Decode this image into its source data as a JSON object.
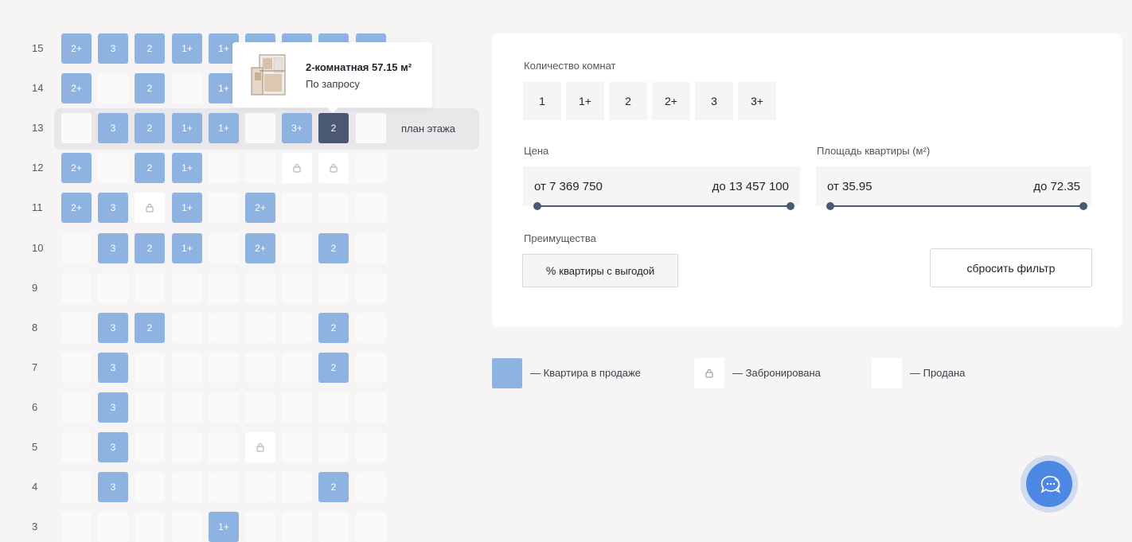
{
  "board": {
    "floors": [
      {
        "floor": "15",
        "cells": [
          {
            "s": "sale",
            "l": "2+"
          },
          {
            "s": "sale",
            "l": "3"
          },
          {
            "s": "sale",
            "l": "2"
          },
          {
            "s": "sale",
            "l": "1+"
          },
          {
            "s": "sale",
            "l": "1+"
          },
          {
            "s": "sale",
            "l": ""
          },
          {
            "s": "sale",
            "l": ""
          },
          {
            "s": "sale",
            "l": ""
          },
          {
            "s": "sale",
            "l": ""
          }
        ]
      },
      {
        "floor": "14",
        "cells": [
          {
            "s": "sale",
            "l": "2+"
          },
          {
            "s": "sold",
            "l": ""
          },
          {
            "s": "sale",
            "l": "2"
          },
          {
            "s": "sold",
            "l": ""
          },
          {
            "s": "sale",
            "l": "1+"
          },
          {
            "s": "sold",
            "l": ""
          },
          {
            "s": "sold",
            "l": ""
          },
          {
            "s": "sold",
            "l": ""
          },
          {
            "s": "sold",
            "l": ""
          }
        ]
      },
      {
        "floor": "13",
        "cells": [
          {
            "s": "sold",
            "l": ""
          },
          {
            "s": "sale",
            "l": "3"
          },
          {
            "s": "sale",
            "l": "2"
          },
          {
            "s": "sale",
            "l": "1+"
          },
          {
            "s": "sale",
            "l": "1+"
          },
          {
            "s": "sold",
            "l": ""
          },
          {
            "s": "sale",
            "l": "3+"
          },
          {
            "s": "active",
            "l": "2"
          },
          {
            "s": "sold",
            "l": ""
          }
        ]
      },
      {
        "floor": "12",
        "cells": [
          {
            "s": "sale",
            "l": "2+"
          },
          {
            "s": "sold",
            "l": ""
          },
          {
            "s": "sale",
            "l": "2"
          },
          {
            "s": "sale",
            "l": "1+"
          },
          {
            "s": "sold",
            "l": ""
          },
          {
            "s": "sold",
            "l": ""
          },
          {
            "s": "booked",
            "l": ""
          },
          {
            "s": "booked",
            "l": ""
          },
          {
            "s": "sold",
            "l": ""
          }
        ]
      },
      {
        "floor": "11",
        "cells": [
          {
            "s": "sale",
            "l": "2+"
          },
          {
            "s": "sale",
            "l": "3"
          },
          {
            "s": "booked",
            "l": ""
          },
          {
            "s": "sale",
            "l": "1+"
          },
          {
            "s": "sold",
            "l": ""
          },
          {
            "s": "sale",
            "l": "2+"
          },
          {
            "s": "sold",
            "l": ""
          },
          {
            "s": "sold",
            "l": ""
          },
          {
            "s": "sold",
            "l": ""
          }
        ]
      },
      {
        "floor": "10",
        "cells": [
          {
            "s": "sold",
            "l": ""
          },
          {
            "s": "sale",
            "l": "3"
          },
          {
            "s": "sale",
            "l": "2"
          },
          {
            "s": "sale",
            "l": "1+"
          },
          {
            "s": "sold",
            "l": ""
          },
          {
            "s": "sale",
            "l": "2+"
          },
          {
            "s": "sold",
            "l": ""
          },
          {
            "s": "sale",
            "l": "2"
          },
          {
            "s": "sold",
            "l": ""
          }
        ]
      },
      {
        "floor": "9",
        "cells": [
          {
            "s": "sold",
            "l": ""
          },
          {
            "s": "sold",
            "l": ""
          },
          {
            "s": "sold",
            "l": ""
          },
          {
            "s": "sold",
            "l": ""
          },
          {
            "s": "sold",
            "l": ""
          },
          {
            "s": "sold",
            "l": ""
          },
          {
            "s": "sold",
            "l": ""
          },
          {
            "s": "sold",
            "l": ""
          },
          {
            "s": "sold",
            "l": ""
          }
        ]
      },
      {
        "floor": "8",
        "cells": [
          {
            "s": "sold",
            "l": ""
          },
          {
            "s": "sale",
            "l": "3"
          },
          {
            "s": "sale",
            "l": "2"
          },
          {
            "s": "sold",
            "l": ""
          },
          {
            "s": "sold",
            "l": ""
          },
          {
            "s": "sold",
            "l": ""
          },
          {
            "s": "sold",
            "l": ""
          },
          {
            "s": "sale",
            "l": "2"
          },
          {
            "s": "sold",
            "l": ""
          }
        ]
      },
      {
        "floor": "7",
        "cells": [
          {
            "s": "sold",
            "l": ""
          },
          {
            "s": "sale",
            "l": "3"
          },
          {
            "s": "sold",
            "l": ""
          },
          {
            "s": "sold",
            "l": ""
          },
          {
            "s": "sold",
            "l": ""
          },
          {
            "s": "sold",
            "l": ""
          },
          {
            "s": "sold",
            "l": ""
          },
          {
            "s": "sale",
            "l": "2"
          },
          {
            "s": "sold",
            "l": ""
          }
        ]
      },
      {
        "floor": "6",
        "cells": [
          {
            "s": "sold",
            "l": ""
          },
          {
            "s": "sale",
            "l": "3"
          },
          {
            "s": "sold",
            "l": ""
          },
          {
            "s": "sold",
            "l": ""
          },
          {
            "s": "sold",
            "l": ""
          },
          {
            "s": "sold",
            "l": ""
          },
          {
            "s": "sold",
            "l": ""
          },
          {
            "s": "sold",
            "l": ""
          },
          {
            "s": "sold",
            "l": ""
          }
        ]
      },
      {
        "floor": "5",
        "cells": [
          {
            "s": "sold",
            "l": ""
          },
          {
            "s": "sale",
            "l": "3"
          },
          {
            "s": "sold",
            "l": ""
          },
          {
            "s": "sold",
            "l": ""
          },
          {
            "s": "sold",
            "l": ""
          },
          {
            "s": "booked",
            "l": ""
          },
          {
            "s": "sold",
            "l": ""
          },
          {
            "s": "sold",
            "l": ""
          },
          {
            "s": "sold",
            "l": ""
          }
        ]
      },
      {
        "floor": "4",
        "cells": [
          {
            "s": "sold",
            "l": ""
          },
          {
            "s": "sale",
            "l": "3"
          },
          {
            "s": "sold",
            "l": ""
          },
          {
            "s": "sold",
            "l": ""
          },
          {
            "s": "sold",
            "l": ""
          },
          {
            "s": "sold",
            "l": ""
          },
          {
            "s": "sold",
            "l": ""
          },
          {
            "s": "sale",
            "l": "2"
          },
          {
            "s": "sold",
            "l": ""
          }
        ]
      },
      {
        "floor": "3",
        "cells": [
          {
            "s": "sold",
            "l": ""
          },
          {
            "s": "sold",
            "l": ""
          },
          {
            "s": "sold",
            "l": ""
          },
          {
            "s": "sold",
            "l": ""
          },
          {
            "s": "sale",
            "l": "1+"
          },
          {
            "s": "sold",
            "l": ""
          },
          {
            "s": "sold",
            "l": ""
          },
          {
            "s": "sold",
            "l": ""
          },
          {
            "s": "sold",
            "l": ""
          }
        ]
      }
    ],
    "floor_plan_link": "план этажа",
    "tooltip": {
      "title": "2-комнатная 57.15 м²",
      "subtitle": "По запросу"
    }
  },
  "filters": {
    "rooms_label": "Количество комнат",
    "rooms": [
      "1",
      "1+",
      "2",
      "2+",
      "3",
      "3+"
    ],
    "price_label": "Цена",
    "price_from": "от 7 369 750",
    "price_to": "до 13 457 100",
    "area_label": "Площадь квартиры (м²)",
    "area_from": "от 35.95",
    "area_to": "до 72.35",
    "benefits_label": "Преимущества",
    "benefit_pct": "%",
    "benefit_button": "квартиры с выгодой",
    "reset_button": "сбросить фильтр"
  },
  "legend": {
    "on_sale": "— Квартира в продаже",
    "booked": "— Забронирована",
    "sold": "— Продана"
  },
  "colors": {
    "on_sale": "#8eb3e0",
    "active": "#4b5874",
    "chat": "#4d87e4"
  }
}
